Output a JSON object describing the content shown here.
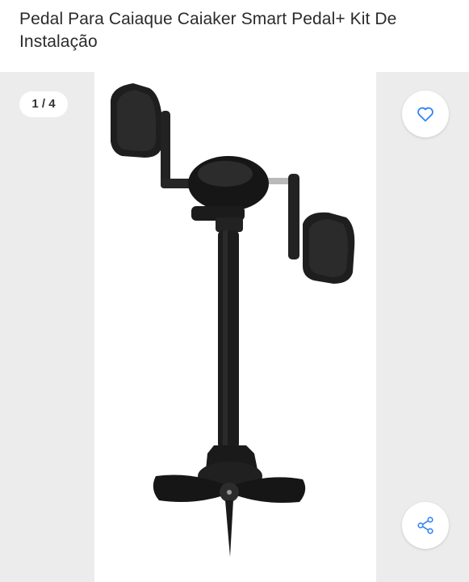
{
  "product": {
    "title": "Pedal Para Caiaque Caiaker Smart Pedal+ Kit De Instalação"
  },
  "gallery": {
    "counter": "1 / 4",
    "current_image": 1,
    "total_images": 4
  },
  "actions": {
    "favorite_icon": "heart-outline-icon",
    "share_icon": "share-icon"
  },
  "colors": {
    "accent": "#3483fa",
    "gallery_background": "#ececec",
    "title_text": "#2b2b2b"
  }
}
